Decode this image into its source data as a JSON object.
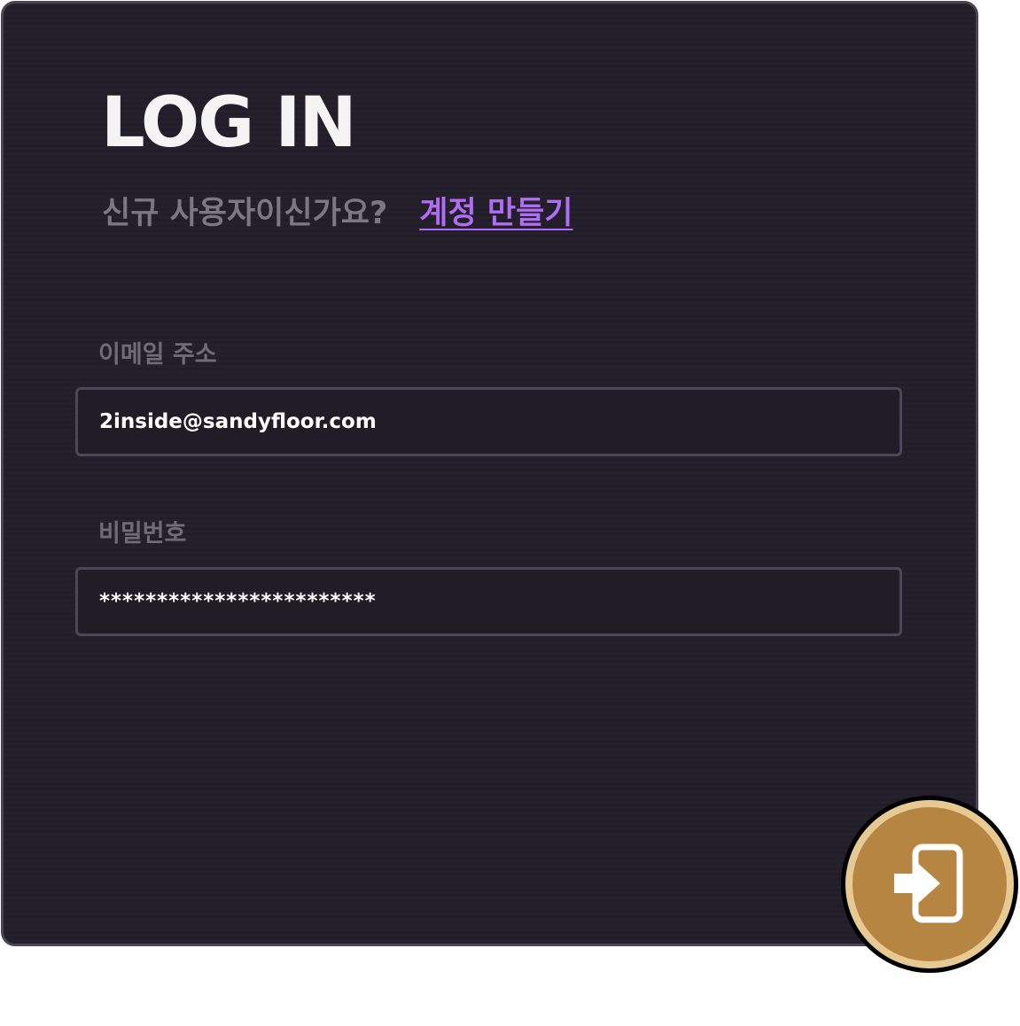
{
  "login": {
    "title": "LOG IN",
    "subtitle": "신규 사용자이신가요?",
    "signup_link": "계정 만들기",
    "email_label": "이메일 주소",
    "email_value": "2inside@sandyfloor.com",
    "password_label": "비밀번호",
    "password_value": "************************",
    "submit_icon": "login-icon"
  },
  "colors": {
    "background": "#25212c",
    "border": "#4a4454",
    "title": "#f4f4f4",
    "muted_text": "#7b7784",
    "link": "#b06cf2",
    "button_gold": "#b68541",
    "button_ring": "#e7c994"
  }
}
